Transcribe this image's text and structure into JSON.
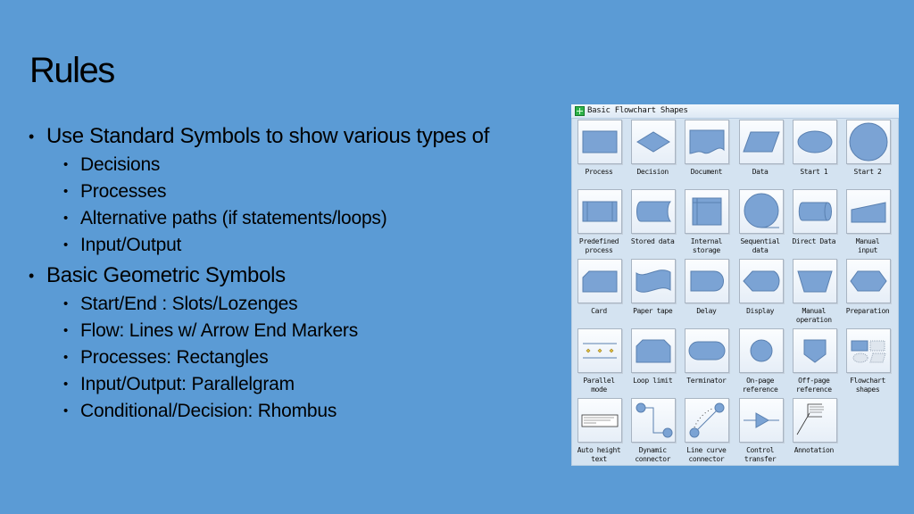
{
  "slide": {
    "title": "Rules",
    "bullets": [
      {
        "text": "Use Standard Symbols to show various types of",
        "children": [
          "Decisions",
          "Processes",
          "Alternative paths (if statements/loops)",
          "Input/Output"
        ]
      },
      {
        "text": "Basic Geometric Symbols",
        "children": [
          "Start/End : Slots/Lozenges",
          "Flow: Lines w/ Arrow End Markers",
          "Processes: Rectangles",
          "Input/Output: Parallelgram",
          "Conditional/Decision: Rhombus"
        ]
      }
    ]
  },
  "panel": {
    "title": "Basic Flowchart Shapes",
    "icon": "flowchart-library-icon",
    "shapes": [
      {
        "label": "Process",
        "icon": "process-shape-icon"
      },
      {
        "label": "Decision",
        "icon": "decision-shape-icon"
      },
      {
        "label": "Document",
        "icon": "document-shape-icon"
      },
      {
        "label": "Data",
        "icon": "data-shape-icon"
      },
      {
        "label": "Start 1",
        "icon": "start1-shape-icon"
      },
      {
        "label": "Start 2",
        "icon": "start2-shape-icon"
      },
      {
        "label": "Predefined\nprocess",
        "icon": "predefined-process-shape-icon"
      },
      {
        "label": "Stored data",
        "icon": "stored-data-shape-icon"
      },
      {
        "label": "Internal\nstorage",
        "icon": "internal-storage-shape-icon"
      },
      {
        "label": "Sequential\ndata",
        "icon": "sequential-data-shape-icon"
      },
      {
        "label": "Direct Data",
        "icon": "direct-data-shape-icon"
      },
      {
        "label": "Manual\ninput",
        "icon": "manual-input-shape-icon"
      },
      {
        "label": "Card",
        "icon": "card-shape-icon"
      },
      {
        "label": "Paper tape",
        "icon": "paper-tape-shape-icon"
      },
      {
        "label": "Delay",
        "icon": "delay-shape-icon"
      },
      {
        "label": "Display",
        "icon": "display-shape-icon"
      },
      {
        "label": "Manual\noperation",
        "icon": "manual-operation-shape-icon"
      },
      {
        "label": "Preparation",
        "icon": "preparation-shape-icon"
      },
      {
        "label": "Parallel\nmode",
        "icon": "parallel-mode-shape-icon"
      },
      {
        "label": "Loop limit",
        "icon": "loop-limit-shape-icon"
      },
      {
        "label": "Terminator",
        "icon": "terminator-shape-icon"
      },
      {
        "label": "On-page\nreference",
        "icon": "on-page-reference-shape-icon"
      },
      {
        "label": "Off-page\nreference",
        "icon": "off-page-reference-shape-icon"
      },
      {
        "label": "Flowchart\nshapes",
        "icon": "flowchart-shapes-icon"
      },
      {
        "label": "Auto height\ntext",
        "icon": "auto-height-text-icon"
      },
      {
        "label": "Dynamic\nconnector",
        "icon": "dynamic-connector-icon"
      },
      {
        "label": "Line curve\nconnector",
        "icon": "line-curve-connector-icon"
      },
      {
        "label": "Control\ntransfer",
        "icon": "control-transfer-icon"
      },
      {
        "label": "Annotation",
        "icon": "annotation-icon"
      }
    ]
  },
  "colors": {
    "background": "#5b9bd5",
    "shape_fill": "#7ba3d4",
    "shape_stroke": "#5a80b0"
  }
}
